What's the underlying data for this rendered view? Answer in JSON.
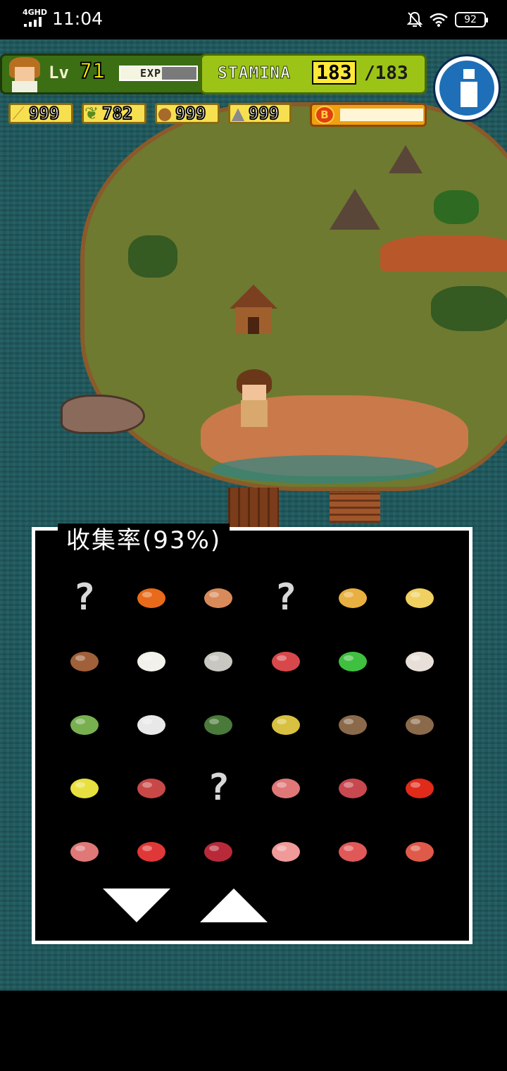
{
  "status_bar": {
    "network": "4GHD",
    "time": "11:04",
    "battery": "92"
  },
  "hud": {
    "level_label": "Lv",
    "level": "71",
    "exp_label": "EXP",
    "exp_fraction": 0.55,
    "stamina_label": "STAMINA",
    "stamina_current": "183",
    "stamina_max": "/183",
    "resources": [
      {
        "name": "wood",
        "icon": "branch-icon",
        "value": "999"
      },
      {
        "name": "herb",
        "icon": "leaf-icon",
        "value": "782"
      },
      {
        "name": "food",
        "icon": "nut-icon",
        "value": "999"
      },
      {
        "name": "stone",
        "icon": "stone-icon",
        "value": "999"
      }
    ],
    "coin_label": "B",
    "coin_fill": 1.0
  },
  "collection": {
    "title": "收集率(93%)",
    "unknown_label": "?",
    "items": [
      {
        "icon": "unknown-item-icon",
        "known": false,
        "color": "#d8d8d8"
      },
      {
        "icon": "carrot-icon",
        "known": true,
        "color": "#e86a1a"
      },
      {
        "icon": "root-icon",
        "known": true,
        "color": "#d88a5a"
      },
      {
        "icon": "unknown-item-icon",
        "known": false,
        "color": "#d8d8d8"
      },
      {
        "icon": "spice-icon",
        "known": true,
        "color": "#e8b040"
      },
      {
        "icon": "ginger-icon",
        "known": true,
        "color": "#f0d060"
      },
      {
        "icon": "seed-icon",
        "known": true,
        "color": "#a0603a"
      },
      {
        "icon": "salt-icon",
        "known": true,
        "color": "#f2f2ea"
      },
      {
        "icon": "rice-icon",
        "known": true,
        "color": "#c8c8c0"
      },
      {
        "icon": "red-salt-icon",
        "known": true,
        "color": "#d8484a"
      },
      {
        "icon": "green-sauce-icon",
        "known": true,
        "color": "#40c040"
      },
      {
        "icon": "tofu-icon",
        "known": true,
        "color": "#e8e0d8"
      },
      {
        "icon": "coconut-icon",
        "known": true,
        "color": "#78b050"
      },
      {
        "icon": "milk-bowl-icon",
        "known": true,
        "color": "#e8e8e8"
      },
      {
        "icon": "seaweed-icon",
        "known": true,
        "color": "#4a7a3a"
      },
      {
        "icon": "soup-bowl-icon",
        "known": true,
        "color": "#d8c040"
      },
      {
        "icon": "water-bowl-icon",
        "known": true,
        "color": "#8a6a4a"
      },
      {
        "icon": "broth-bowl-icon",
        "known": true,
        "color": "#8a6a4a"
      },
      {
        "icon": "lemon-icon",
        "known": true,
        "color": "#e8e040"
      },
      {
        "icon": "meat-skewer-icon",
        "known": true,
        "color": "#c84848"
      },
      {
        "icon": "unknown-item-icon",
        "known": false,
        "color": "#d8d8d8"
      },
      {
        "icon": "ham-icon",
        "known": true,
        "color": "#e07878"
      },
      {
        "icon": "beef-icon",
        "known": true,
        "color": "#c84850"
      },
      {
        "icon": "crab-icon",
        "known": true,
        "color": "#e02a1a"
      },
      {
        "icon": "pork-icon",
        "known": true,
        "color": "#e07878"
      },
      {
        "icon": "drumstick-icon",
        "known": true,
        "color": "#e03838"
      },
      {
        "icon": "red-meat-icon",
        "known": true,
        "color": "#b82a3a"
      },
      {
        "icon": "fish-fillet-icon",
        "known": true,
        "color": "#f09a9a"
      },
      {
        "icon": "minced-meat-icon",
        "known": true,
        "color": "#e05858"
      },
      {
        "icon": "shrimp-icon",
        "known": true,
        "color": "#e05a4a"
      }
    ]
  }
}
